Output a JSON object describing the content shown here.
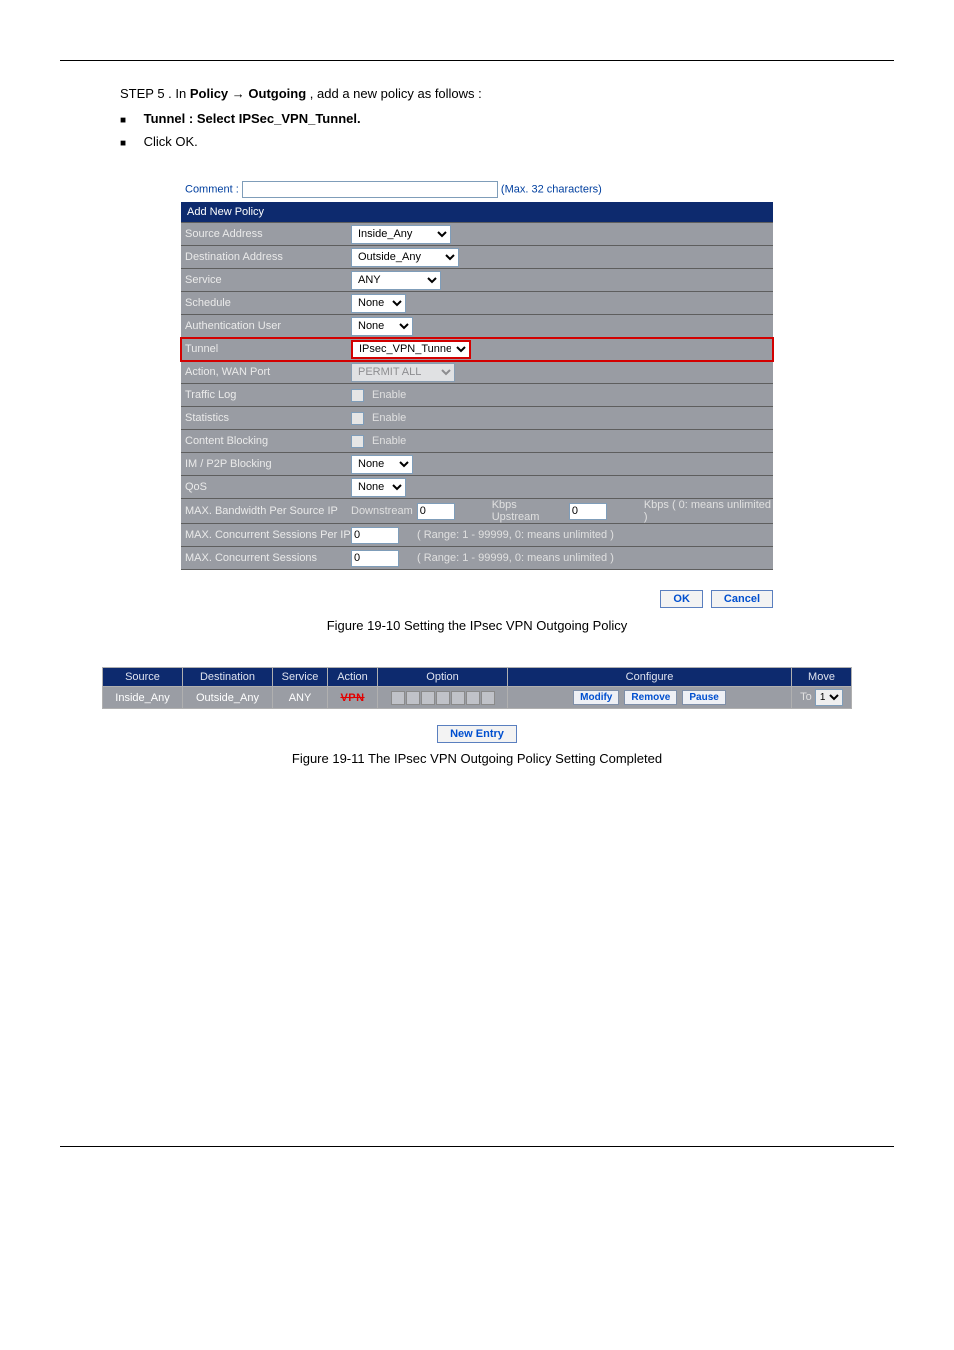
{
  "stepText": {
    "prefix": "STEP 5 . In ",
    "boldA": "Policy ",
    "arrow": "→",
    "mid": " Outgoing",
    "after": ", add a new policy as follows :"
  },
  "bullets": [
    "Tunnel : Select IPSec_VPN_Tunnel.",
    "Click OK."
  ],
  "commentLabel": "Comment :",
  "commentHint": "(Max. 32 characters)",
  "sectionHeader": "Add New Policy",
  "rows": {
    "sourceAddress": {
      "label": "Source Address",
      "value": "Inside_Any"
    },
    "destAddress": {
      "label": "Destination Address",
      "value": "Outside_Any"
    },
    "service": {
      "label": "Service",
      "value": "ANY"
    },
    "schedule": {
      "label": "Schedule",
      "value": "None"
    },
    "authUser": {
      "label": "Authentication User",
      "value": "None"
    },
    "tunnel": {
      "label": "Tunnel",
      "value": "IPsec_VPN_Tunnel"
    },
    "actionWan": {
      "label": "Action, WAN Port",
      "value": "PERMIT ALL"
    },
    "trafficLog": {
      "label": "Traffic Log",
      "checkLabel": "Enable"
    },
    "statistics": {
      "label": "Statistics",
      "checkLabel": "Enable"
    },
    "contentBlk": {
      "label": "Content Blocking",
      "checkLabel": "Enable"
    },
    "imp2p": {
      "label": "IM / P2P Blocking",
      "value": "None"
    },
    "qos": {
      "label": "QoS",
      "value": "None"
    },
    "maxBw": {
      "label": "MAX. Bandwidth Per Source IP",
      "down": "Downstream",
      "downVal": "0",
      "up": "Kbps Upstream",
      "upVal": "0",
      "note": "Kbps ( 0: means unlimited )"
    },
    "maxSessSrc": {
      "label": "MAX. Concurrent Sessions Per IP",
      "val": "0",
      "note": "( Range: 1 - 99999, 0: means unlimited )"
    },
    "maxSess": {
      "label": "MAX. Concurrent Sessions",
      "val": "0",
      "note": "( Range: 1 - 99999, 0: means unlimited )"
    }
  },
  "buttons": {
    "ok": "OK",
    "cancel": "Cancel"
  },
  "figCaption1": "Figure 19-10 Setting the IPsec VPN Outgoing Policy",
  "tableHeaders": [
    "Source",
    "Destination",
    "Service",
    "Action",
    "Option",
    "Configure",
    "Move"
  ],
  "tableRow": {
    "source": "Inside_Any",
    "dest": "Outside_Any",
    "service": "ANY",
    "action": "VPN",
    "modify": "Modify",
    "remove": "Remove",
    "pause": "Pause",
    "moveLabel": "To",
    "moveVal": "1"
  },
  "newEntry": "New Entry",
  "figCaption2": "Figure 19-11 The IPsec VPN Outgoing Policy Setting Completed"
}
